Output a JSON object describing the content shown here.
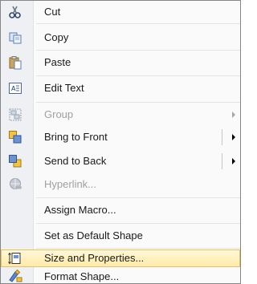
{
  "menu": {
    "items": [
      {
        "id": "cut",
        "label": "Cut",
        "icon": "scissors-icon",
        "disabled": false
      },
      {
        "id": "copy",
        "label": "Copy",
        "icon": "copy-icon",
        "disabled": false
      },
      {
        "id": "paste",
        "label": "Paste",
        "icon": "paste-icon",
        "disabled": false
      },
      {
        "id": "edit-text",
        "label": "Edit Text",
        "icon": "edit-text-icon",
        "disabled": false
      },
      {
        "id": "group",
        "label": "Group",
        "icon": "group-icon",
        "disabled": true,
        "submenu": true
      },
      {
        "id": "bring-to-front",
        "label": "Bring to Front",
        "icon": "bring-to-front-icon",
        "disabled": false,
        "submenu": true
      },
      {
        "id": "send-to-back",
        "label": "Send to Back",
        "icon": "send-to-back-icon",
        "disabled": false,
        "submenu": true
      },
      {
        "id": "hyperlink",
        "label": "Hyperlink...",
        "icon": "hyperlink-icon",
        "disabled": true
      },
      {
        "id": "assign-macro",
        "label": "Assign Macro...",
        "disabled": false
      },
      {
        "id": "set-default-shape",
        "label": "Set as Default Shape",
        "disabled": false
      },
      {
        "id": "size-and-properties",
        "label": "Size and Properties...",
        "icon": "size-properties-icon",
        "disabled": false,
        "highlighted": true
      },
      {
        "id": "format-shape",
        "label": "Format Shape...",
        "icon": "format-shape-icon",
        "disabled": false
      }
    ]
  }
}
